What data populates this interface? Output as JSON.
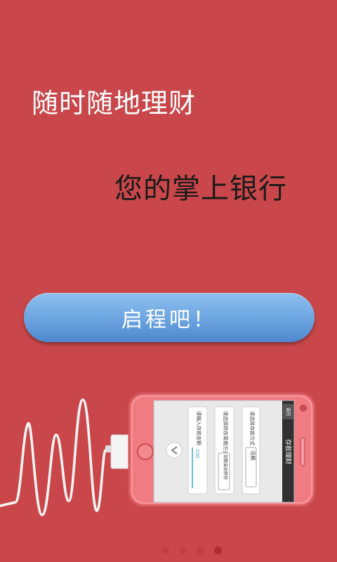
{
  "onboarding": {
    "tagline_primary": "随时随地理财",
    "tagline_secondary": "您的掌上银行",
    "start_button_label": "启程吧！"
  },
  "phone": {
    "header_title": "存款理财",
    "back_label": "返回",
    "fields": [
      {
        "label": "请选择存款方式",
        "value": "活期"
      },
      {
        "label": "请选择转存周期方式",
        "value": "到期自动转存"
      },
      {
        "label": "请输入存款金额",
        "value": "100"
      }
    ]
  },
  "pager": {
    "total": 4,
    "active_index": 3
  },
  "colors": {
    "background": "#c9474a",
    "button_blue": "#6fa7e2",
    "phone_body": "#f07b80",
    "dot_active": "#b02a30"
  }
}
